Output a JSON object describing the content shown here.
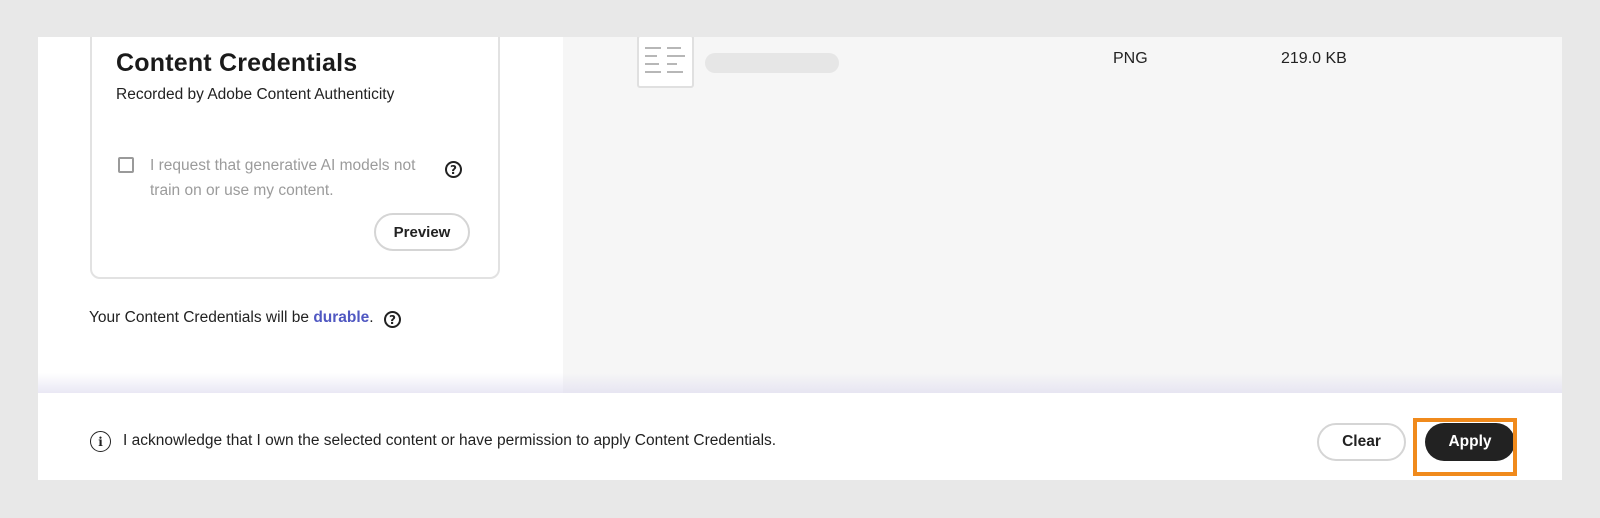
{
  "content_credentials": {
    "title": "Content Credentials",
    "subtitle": "Recorded by Adobe Content Authenticity",
    "ai_opt_out_label": "I request that generative AI models not train on or use my content.",
    "ai_opt_out_checked": false,
    "preview_label": "Preview"
  },
  "durability": {
    "prefix": "Your Content Credentials will be ",
    "link_text": "durable",
    "suffix": "."
  },
  "file_list": {
    "items": [
      {
        "type": "PNG",
        "size": "219.0 KB"
      }
    ]
  },
  "footer": {
    "acknowledgement": "I acknowledge that I own the selected content or have permission to apply Content Credentials.",
    "clear_label": "Clear",
    "apply_label": "Apply"
  },
  "colors": {
    "link": "#5058c2",
    "primary_button": "#222222",
    "highlight": "#f08a1c",
    "panel_background": "#f6f6f6"
  },
  "icons": [
    "help-icon",
    "info-icon",
    "file-thumbnail-icon"
  ]
}
